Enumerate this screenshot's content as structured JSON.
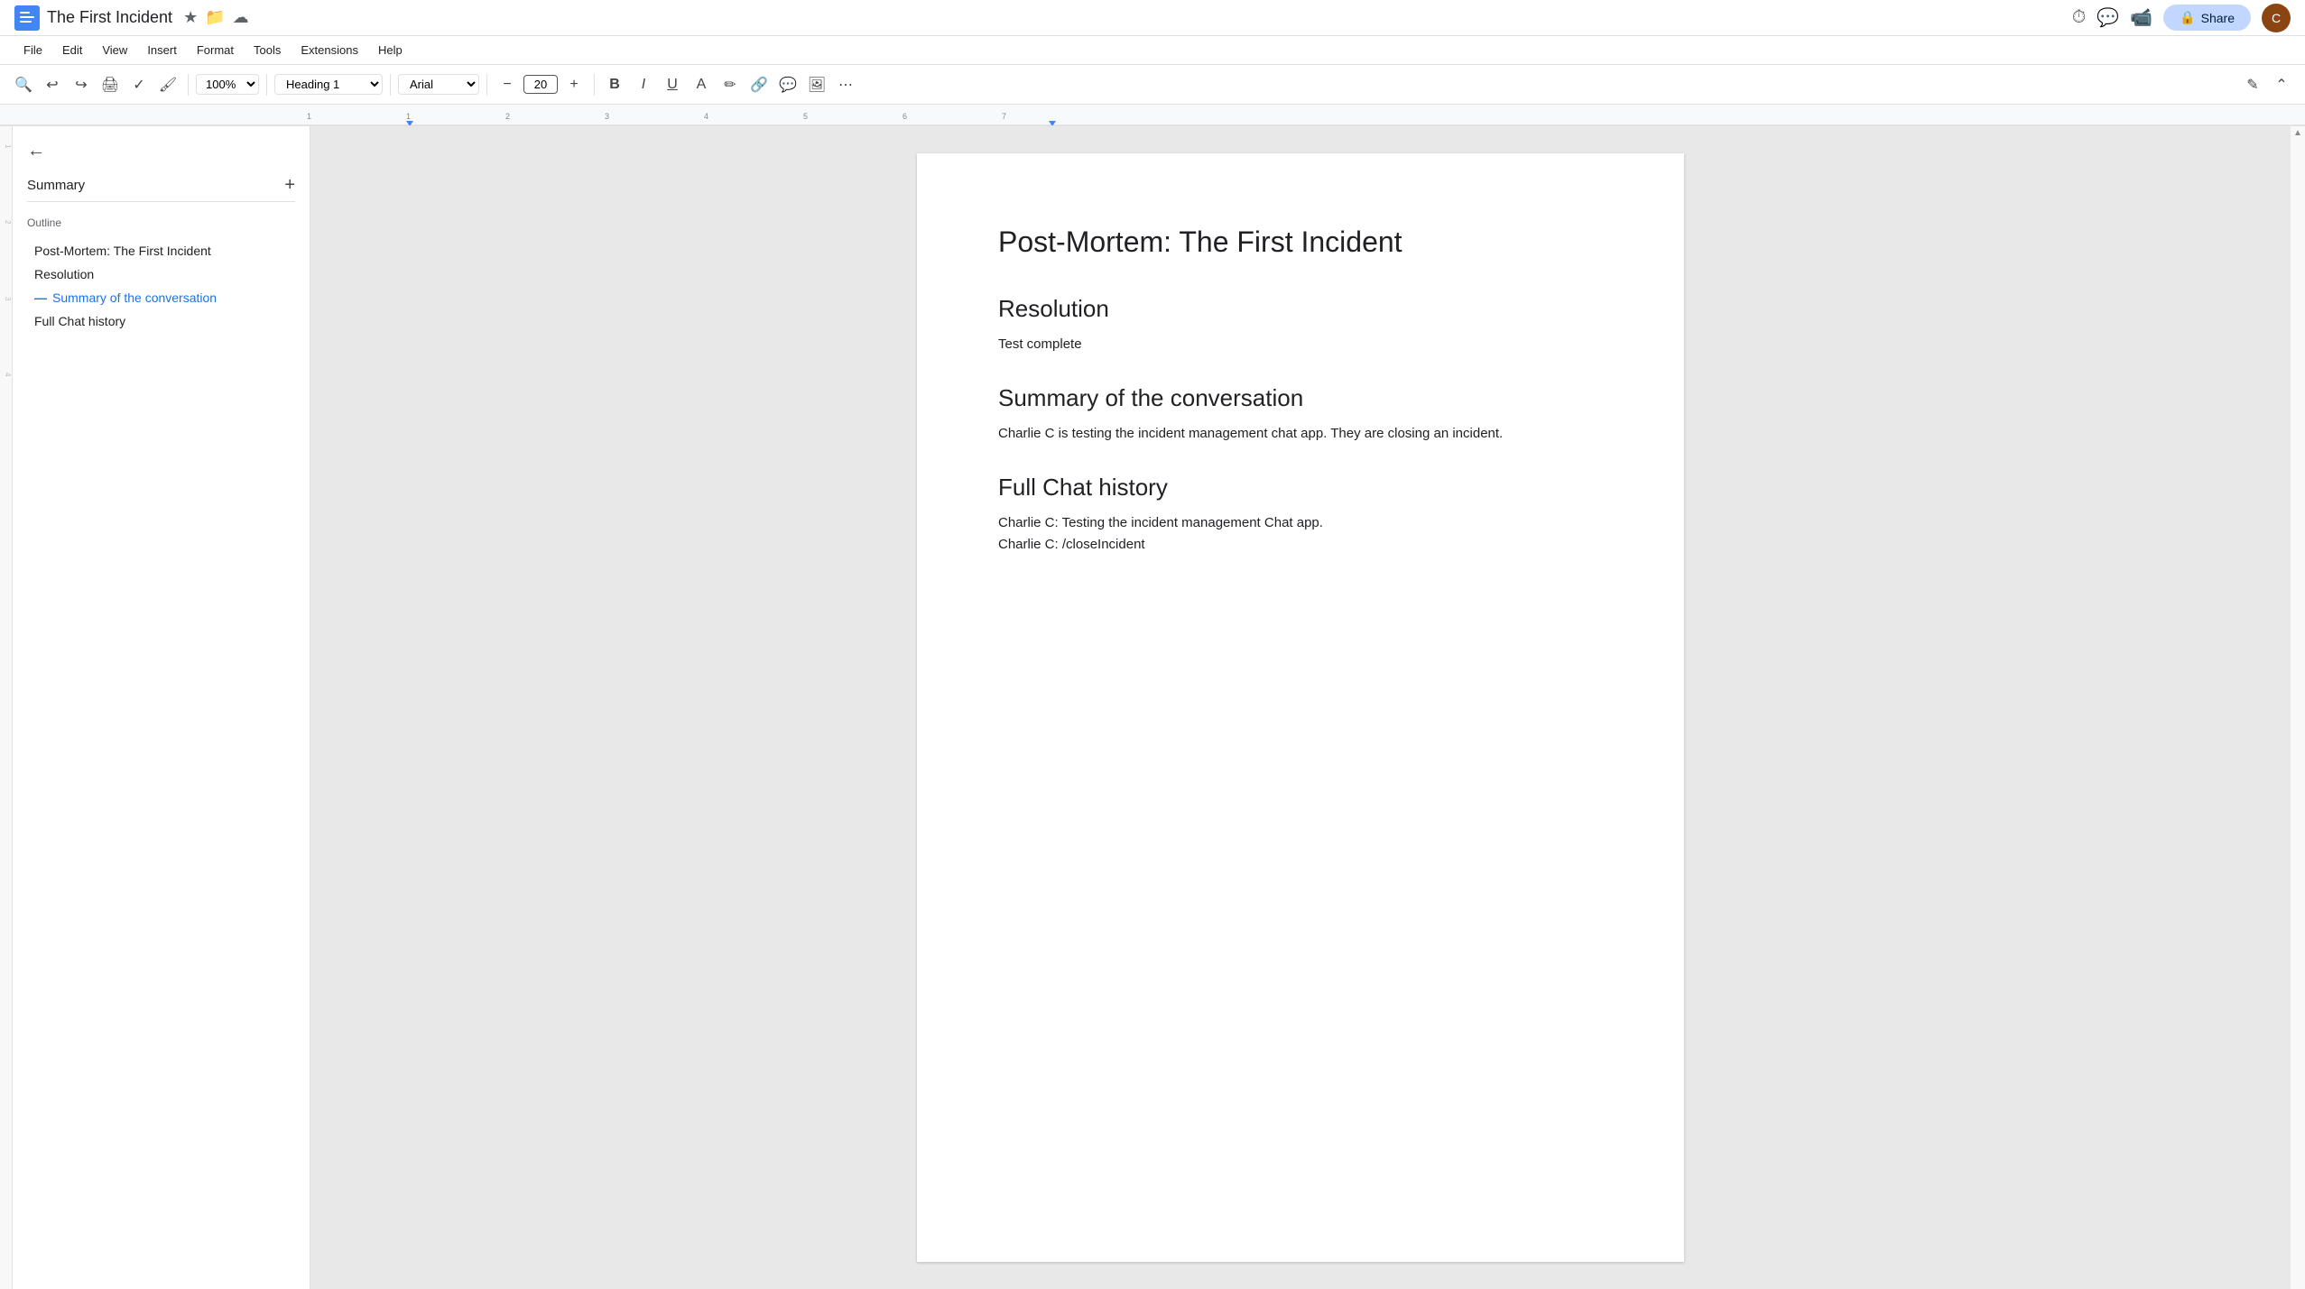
{
  "titleBar": {
    "docTitle": "The First Incident",
    "appIconSymbol": "📄",
    "starIcon": "★",
    "folderIcon": "📁",
    "cloudIcon": "☁",
    "shareLabel": "Share",
    "avatarInitial": "C"
  },
  "menuBar": {
    "items": [
      "File",
      "Edit",
      "View",
      "Insert",
      "Format",
      "Tools",
      "Extensions",
      "Help"
    ]
  },
  "toolbar": {
    "searchIcon": "🔍",
    "undoIcon": "↩",
    "redoIcon": "↪",
    "printIcon": "🖨",
    "spellcheckIcon": "✓",
    "paintIcon": "🖌",
    "zoomValue": "100%",
    "styleValue": "Heading 1",
    "fontValue": "Arial",
    "fontSizeValue": "20",
    "decreaseFontIcon": "−",
    "increaseFontIcon": "+",
    "boldLabel": "B",
    "italicLabel": "I",
    "underlineLabel": "U",
    "textColorIcon": "A",
    "highlightIcon": "✏",
    "linkIcon": "🔗",
    "commentIcon": "💬",
    "imageIcon": "🖼",
    "moreIcon": "⋯",
    "editIcon": "✎",
    "collapseIcon": "⌃"
  },
  "sidebar": {
    "backArrow": "←",
    "summaryLabel": "Summary",
    "addIcon": "+",
    "outlineLabel": "Outline",
    "outlineItems": [
      {
        "label": "Post-Mortem: The First Incident",
        "active": false
      },
      {
        "label": "Resolution",
        "active": false
      },
      {
        "label": "Summary of the conversation",
        "active": true
      },
      {
        "label": "Full Chat history",
        "active": false
      }
    ]
  },
  "document": {
    "title": "Post-Mortem: The First Incident",
    "sections": [
      {
        "heading": "Resolution",
        "body": "Test complete"
      },
      {
        "heading": "Summary of the conversation",
        "body": "Charlie C is testing the incident management chat app. They are closing an incident."
      },
      {
        "heading": "Full Chat history",
        "lines": [
          "Charlie C: Testing the incident management Chat app.",
          "Charlie C: /closeIncident"
        ]
      }
    ]
  }
}
